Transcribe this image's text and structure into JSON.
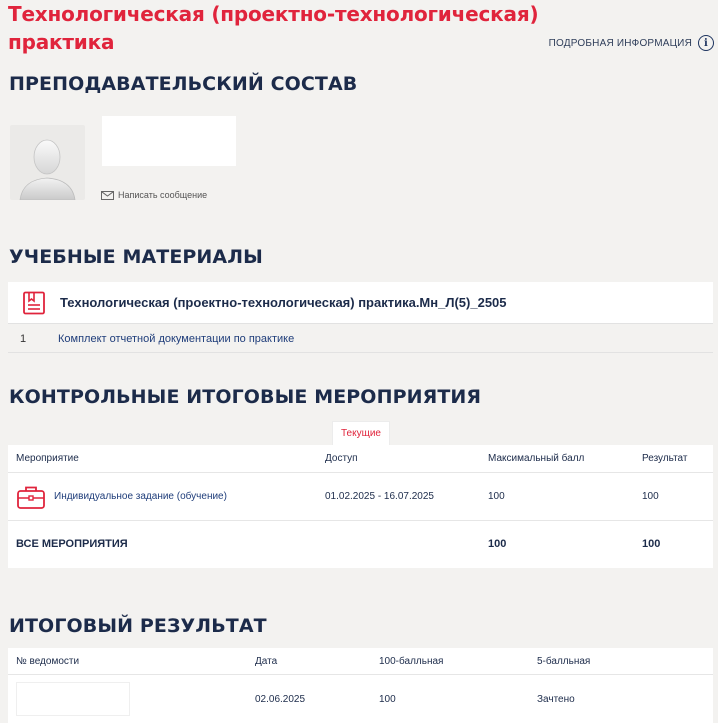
{
  "course": {
    "title": "Технологическая (проектно-технологическая) практика",
    "more_info": "ПОДРОБНАЯ ИНФОРМАЦИЯ"
  },
  "teachers": {
    "heading": "ПРЕПОДАВАТЕЛЬСКИЙ СОСТАВ",
    "write_message": "Написать сообщение"
  },
  "materials": {
    "heading": "УЧЕБНЫЕ МАТЕРИАЛЫ",
    "card_title": "Технологическая (проектно-технологическая) практика.Мн_Л(5)_2505",
    "items": [
      {
        "num": "1",
        "label": "Комплект отчетной документации по практике"
      }
    ]
  },
  "control_events": {
    "heading": "КОНТРОЛЬНЫЕ ИТОГОВЫЕ МЕРОПРИЯТИЯ",
    "tab_current": "Текущие",
    "columns": [
      "Мероприятие",
      "Доступ",
      "Максимальный балл",
      "Результат"
    ],
    "rows": [
      {
        "event": "Индивидуальное задание (обучение)",
        "access": "01.02.2025 - 16.07.2025",
        "max_score": "100",
        "result": "100"
      }
    ],
    "total": {
      "label": "ВСЕ МЕРОПРИЯТИЯ",
      "max_score": "100",
      "result": "100"
    }
  },
  "final_result": {
    "heading": "ИТОГОВЫЙ РЕЗУЛЬТАТ",
    "columns": [
      "№ ведомости",
      "Дата",
      "100-балльная",
      "5-балльная"
    ],
    "rows": [
      {
        "date": "02.06.2025",
        "score100": "100",
        "score5": "Зачтено"
      }
    ]
  },
  "colors": {
    "accent_red": "#e0243c",
    "heading_navy": "#1c2b4a",
    "link_blue": "#1f3d7a",
    "background": "#f3f2f0"
  }
}
